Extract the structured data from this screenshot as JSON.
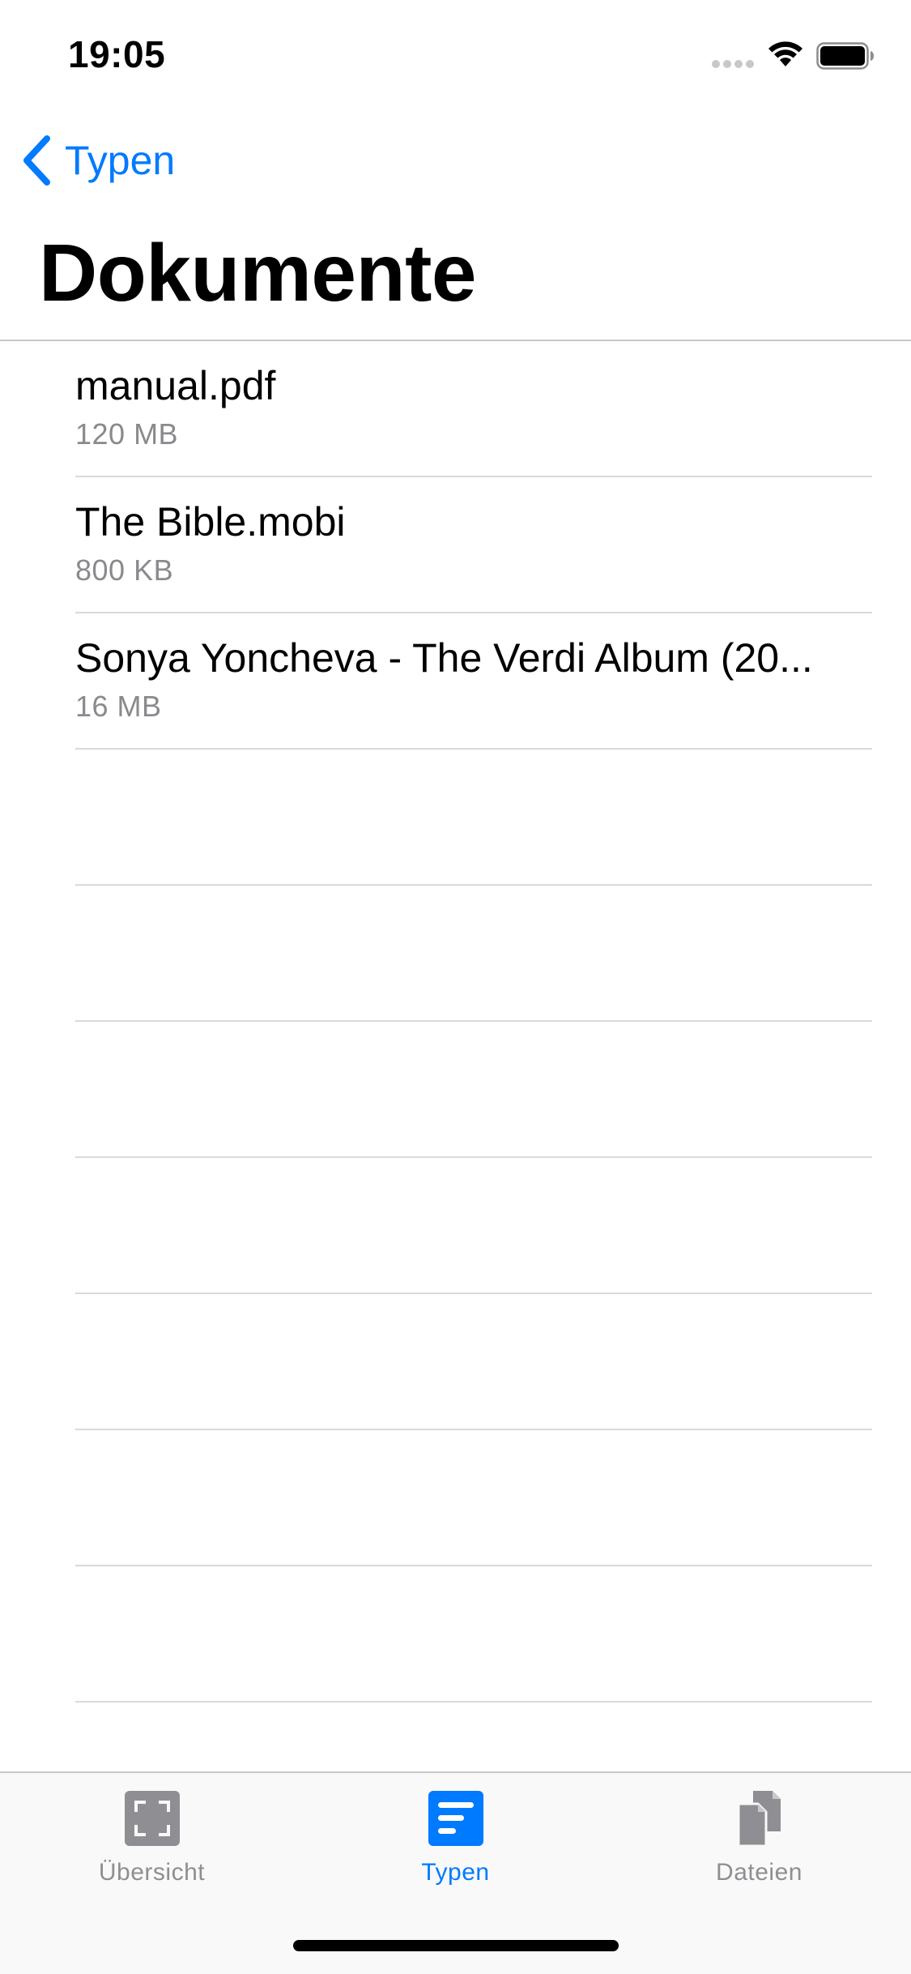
{
  "status_bar": {
    "time": "19:05"
  },
  "nav": {
    "back_label": "Typen",
    "title": "Dokumente"
  },
  "files": [
    {
      "name": "manual.pdf",
      "size": "120 MB"
    },
    {
      "name": "The Bible.mobi",
      "size": "800 KB"
    },
    {
      "name": "Sonya Yoncheva - The Verdi Album (20...",
      "size": "16 MB"
    }
  ],
  "tab_bar": {
    "tabs": [
      {
        "label": "Übersicht",
        "icon": "overview-icon",
        "active": false
      },
      {
        "label": "Typen",
        "icon": "types-icon",
        "active": true
      },
      {
        "label": "Dateien",
        "icon": "files-icon",
        "active": false
      }
    ]
  },
  "colors": {
    "accent": "#007aff",
    "inactive": "#8e8e93",
    "secondary_text": "#8a8a8e",
    "separator": "#d9d9de"
  }
}
